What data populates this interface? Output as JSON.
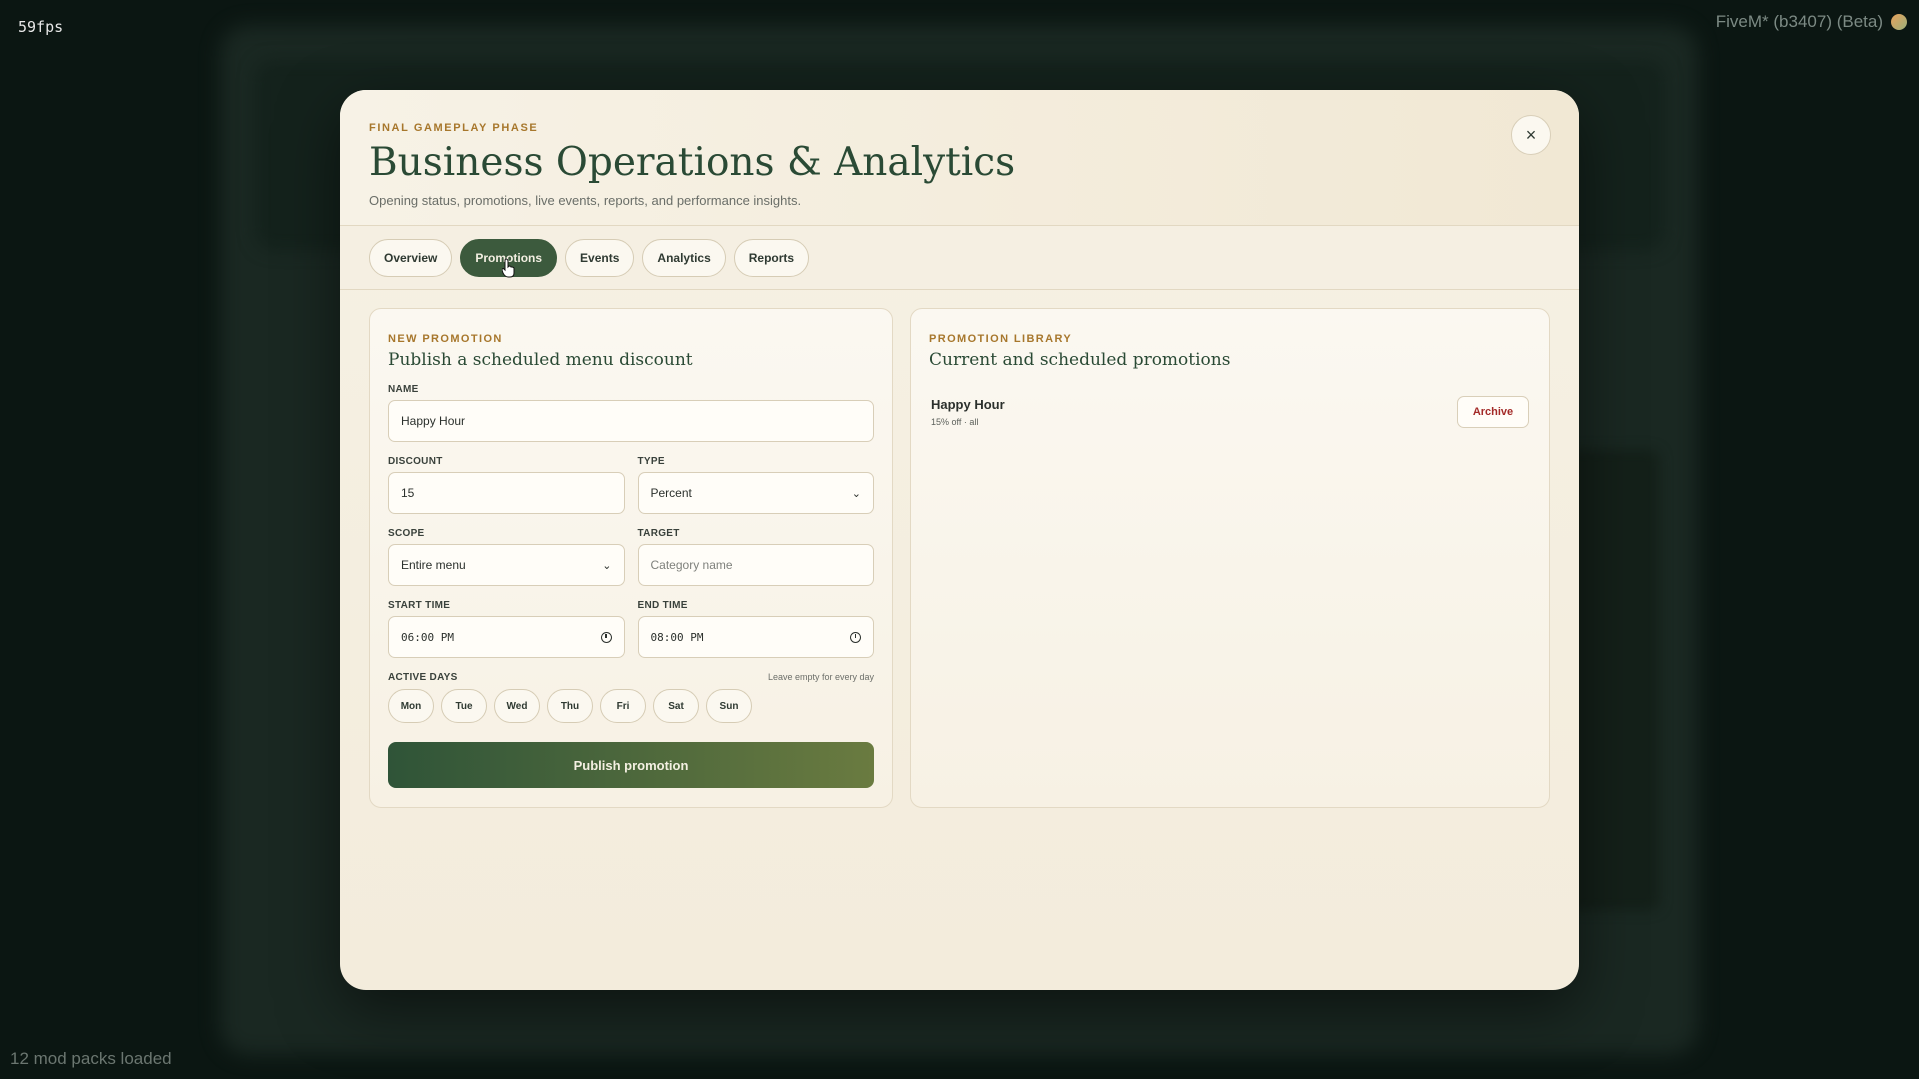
{
  "overlay": {
    "fps": "59fps",
    "client_title": "FiveM* (b3407) (Beta)",
    "mods_loaded": "12 mod packs loaded"
  },
  "modal": {
    "eyebrow": "FINAL GAMEPLAY PHASE",
    "title": "Business Operations & Analytics",
    "subtitle": "Opening status, promotions, live events, reports, and performance insights.",
    "close_label": "×"
  },
  "tabs": [
    {
      "label": "Overview",
      "active": false
    },
    {
      "label": "Promotions",
      "active": true
    },
    {
      "label": "Events",
      "active": false
    },
    {
      "label": "Analytics",
      "active": false
    },
    {
      "label": "Reports",
      "active": false
    }
  ],
  "new_promotion": {
    "eyebrow": "NEW PROMOTION",
    "title": "Publish a scheduled menu discount",
    "name_label": "NAME",
    "name_value": "Happy Hour",
    "discount_label": "DISCOUNT",
    "discount_value": "15",
    "type_label": "TYPE",
    "type_value": "Percent",
    "scope_label": "SCOPE",
    "scope_value": "Entire menu",
    "target_label": "TARGET",
    "target_placeholder": "Category name",
    "start_label": "START TIME",
    "start_value": "06:00 PM",
    "end_label": "END TIME",
    "end_value": "08:00 PM",
    "active_days_label": "ACTIVE DAYS",
    "active_days_hint": "Leave empty for every day",
    "days": [
      "Mon",
      "Tue",
      "Wed",
      "Thu",
      "Fri",
      "Sat",
      "Sun"
    ],
    "publish_label": "Publish promotion"
  },
  "library": {
    "eyebrow": "PROMOTION LIBRARY",
    "title": "Current and scheduled promotions",
    "items": [
      {
        "name": "Happy Hour",
        "meta": "15% off · all",
        "action": "Archive"
      }
    ]
  },
  "colors": {
    "accent_green": "#3c5a3d",
    "eyebrow_gold": "#a7772c",
    "danger_red": "#a32a28"
  }
}
